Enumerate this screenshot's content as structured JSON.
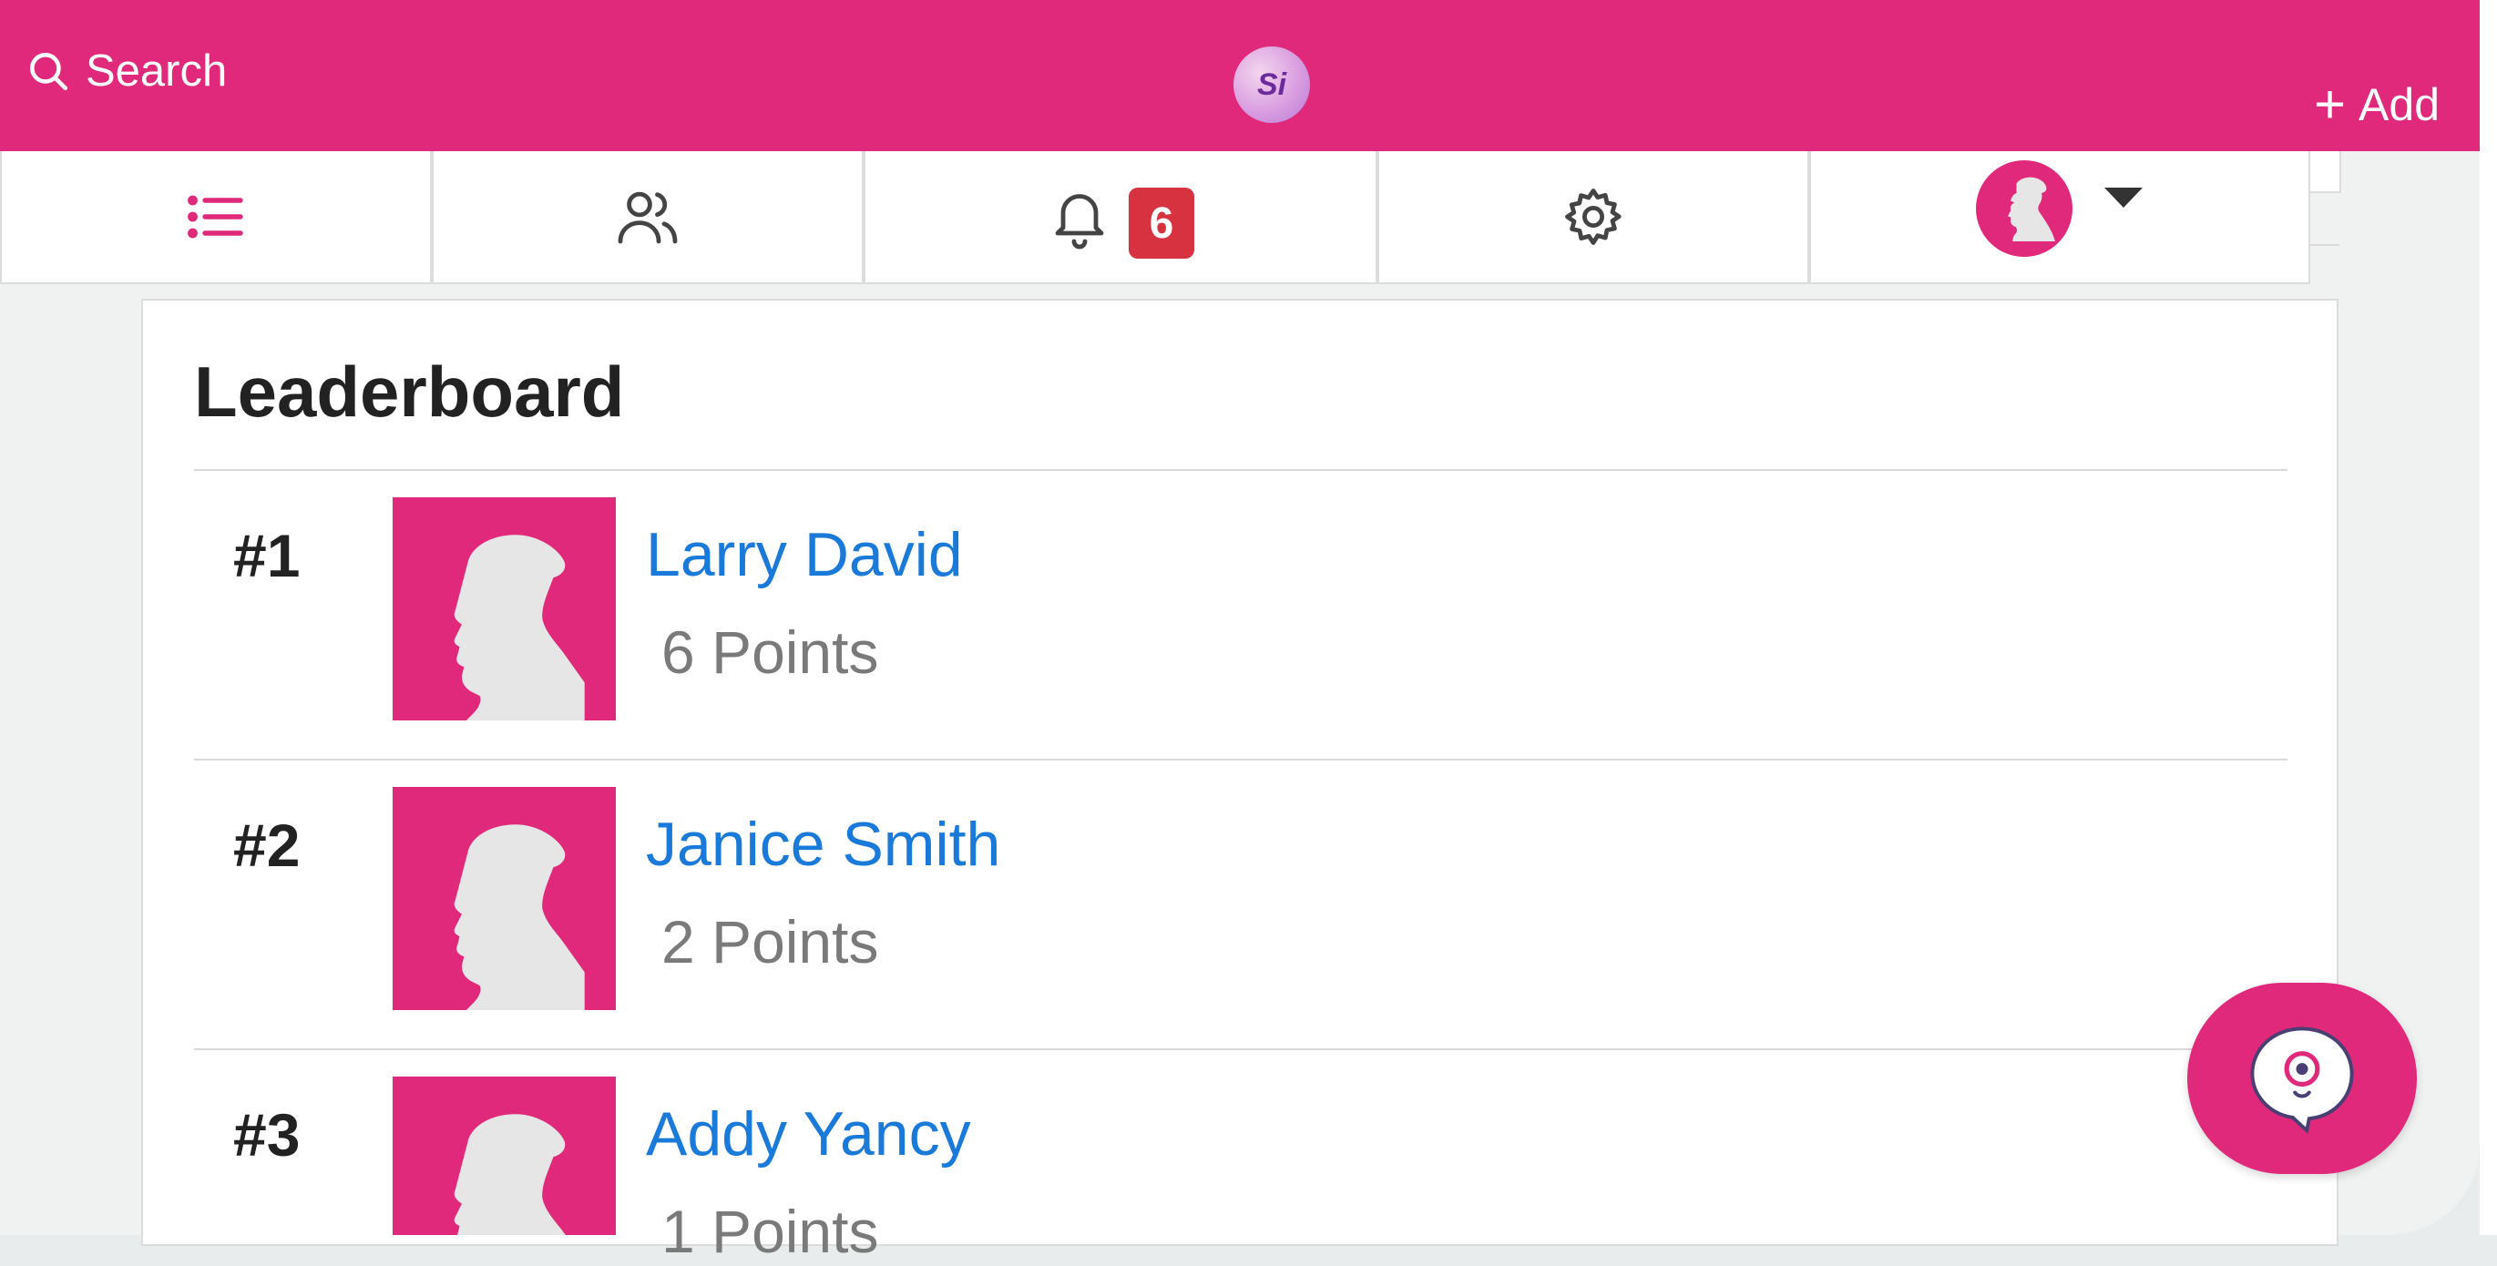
{
  "colors": {
    "brand": "#e0297a",
    "link": "#1a7ad9",
    "badge": "#d6323f"
  },
  "topbar": {
    "search_label": "Search",
    "logo_text": "Si",
    "add_label": "Add"
  },
  "nav": {
    "icons": [
      "list-icon",
      "people-icon",
      "bell-icon",
      "gear-icon",
      "profile-avatar"
    ],
    "notifications_count": "6"
  },
  "leaderboard": {
    "title": "Leaderboard",
    "entries": [
      {
        "rank": "#1",
        "name": "Larry David",
        "points": "6 Points"
      },
      {
        "rank": "#2",
        "name": "Janice Smith",
        "points": "2 Points"
      },
      {
        "rank": "#3",
        "name": "Addy Yancy",
        "points": "1 Points"
      }
    ]
  }
}
